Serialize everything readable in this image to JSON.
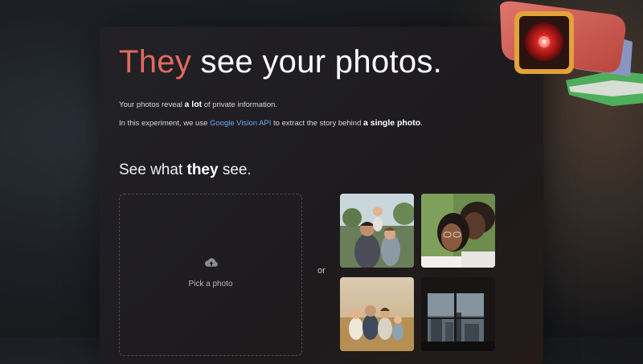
{
  "headline": {
    "accent": "They",
    "rest": " see your photos."
  },
  "intro": {
    "line1_before": "Your photos reveal ",
    "line1_bold": "a lot",
    "line1_after": " of private information.",
    "line2_before": "In this experiment, we use ",
    "line2_link": "Google Vision API",
    "line2_middle": " to extract the story behind ",
    "line2_bold": "a single photo",
    "line2_after": "."
  },
  "subhead": {
    "before": "See what ",
    "bold": "they",
    "after": " see."
  },
  "upload": {
    "label": "Pick a photo",
    "icon": "cloud-upload-icon"
  },
  "separator": "or",
  "samples": [
    {
      "name": "family-outdoor-photo"
    },
    {
      "name": "couple-portrait-photo"
    },
    {
      "name": "family-field-photo"
    },
    {
      "name": "city-window-photo"
    }
  ],
  "colors": {
    "accent": "#e06a5e",
    "link": "#6fa8f5",
    "card_bg": "#1f1d20"
  },
  "decoration": {
    "icon": "security-camera-icon"
  }
}
